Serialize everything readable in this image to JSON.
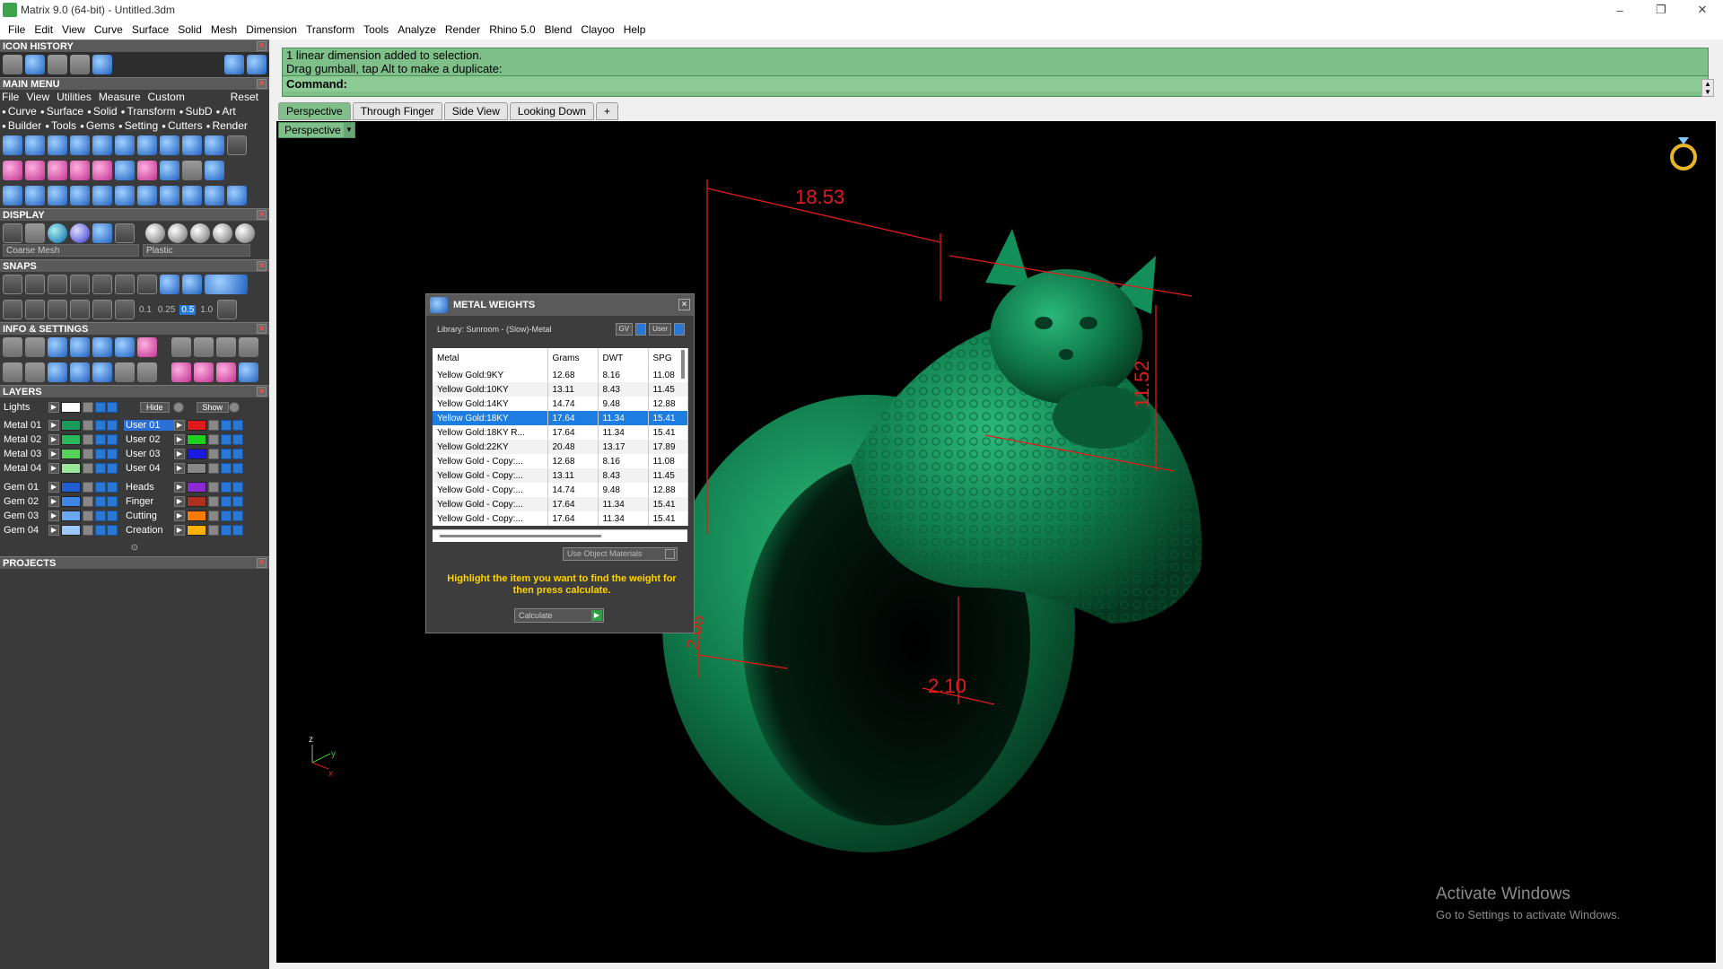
{
  "window": {
    "title": "Matrix 9.0 (64-bit) - Untitled.3dm",
    "controls": {
      "minimize": "–",
      "restore": "❐",
      "close": "✕"
    }
  },
  "menubar": [
    "File",
    "Edit",
    "View",
    "Curve",
    "Surface",
    "Solid",
    "Mesh",
    "Dimension",
    "Transform",
    "Tools",
    "Analyze",
    "Render",
    "Rhino 5.0",
    "Blend",
    "Clayoo",
    "Help"
  ],
  "left_panel": {
    "icon_history_title": "ICON HISTORY",
    "main_menu_title": "MAIN MENU",
    "main_menu_items": [
      "File",
      "View",
      "Utilities",
      "Measure",
      "Custom"
    ],
    "reset_label": "Reset",
    "categories_row1": [
      "Curve",
      "Surface",
      "Solid",
      "Transform",
      "SubD",
      "Art"
    ],
    "categories_row2": [
      "Builder",
      "Tools",
      "Gems",
      "Setting",
      "Cutters",
      "Render"
    ],
    "display_title": "DISPLAY",
    "display_mesh": "Coarse Mesh",
    "display_material": "Plastic",
    "snaps_title": "SNAPS",
    "snap_values": [
      "0.1",
      "0.25",
      "0.5",
      "1.0"
    ],
    "info_title": "INFO & SETTINGS",
    "layers_title": "LAYERS",
    "lights_label": "Lights",
    "hide_label": "Hide",
    "show_label": "Show",
    "layers_left": [
      {
        "name": "Metal 01",
        "color": "#1a9a5a"
      },
      {
        "name": "Metal 02",
        "color": "#2bb85c"
      },
      {
        "name": "Metal 03",
        "color": "#56d25a"
      },
      {
        "name": "Metal 04",
        "color": "#9be89a"
      },
      {
        "name": "Gem 01",
        "color": "#1f5fd0"
      },
      {
        "name": "Gem 02",
        "color": "#3f86e6"
      },
      {
        "name": "Gem 03",
        "color": "#6aa8f0"
      },
      {
        "name": "Gem 04",
        "color": "#9cc8f7"
      }
    ],
    "layers_right": [
      {
        "name": "User 01",
        "color": "#e01a1a"
      },
      {
        "name": "User 02",
        "color": "#20d020"
      },
      {
        "name": "User 03",
        "color": "#1a1ae0"
      },
      {
        "name": "User 04",
        "color": "#888888"
      },
      {
        "name": "Heads",
        "color": "#8a2ad0"
      },
      {
        "name": "Finger",
        "color": "#b03020"
      },
      {
        "name": "Cutting",
        "color": "#ff7a00"
      },
      {
        "name": "Creation",
        "color": "#ffb000"
      }
    ],
    "projects_title": "PROJECTS"
  },
  "command": {
    "line1": "1 linear dimension added to selection.",
    "line2": "Drag gumball, tap Alt to make a duplicate:",
    "prompt": "Command:"
  },
  "view_tabs": [
    "Perspective",
    "Through Finger",
    "Side View",
    "Looking Down"
  ],
  "add_tab_label": "+",
  "viewport": {
    "label": "Perspective",
    "dimensions": [
      "18.53",
      "11.52",
      "2.05",
      "2.10"
    ],
    "axis_z": "z",
    "axis_y": "y",
    "axis_x": "x",
    "model_color": "#0f7a4a"
  },
  "metal_weights": {
    "title": "METAL WEIGHTS",
    "library": "Library: Sunroom - (Slow)-Metal",
    "btn_gv": "GV",
    "btn_user": "User",
    "columns": [
      "Metal",
      "Grams",
      "DWT",
      "SPG"
    ],
    "rows": [
      [
        "Yellow Gold:9KY",
        "12.68",
        "8.16",
        "11.08"
      ],
      [
        "Yellow Gold:10KY",
        "13.11",
        "8.43",
        "11.45"
      ],
      [
        "Yellow Gold:14KY",
        "14.74",
        "9.48",
        "12.88"
      ],
      [
        "Yellow Gold:18KY",
        "17.64",
        "11.34",
        "15.41"
      ],
      [
        "Yellow Gold:18KY R...",
        "17.64",
        "11.34",
        "15.41"
      ],
      [
        "Yellow Gold:22KY",
        "20.48",
        "13.17",
        "17.89"
      ],
      [
        "Yellow Gold - Copy:...",
        "12.68",
        "8.16",
        "11.08"
      ],
      [
        "Yellow Gold - Copy:...",
        "13.11",
        "8.43",
        "11.45"
      ],
      [
        "Yellow Gold - Copy:...",
        "14.74",
        "9.48",
        "12.88"
      ],
      [
        "Yellow Gold - Copy:...",
        "17.64",
        "11.34",
        "15.41"
      ],
      [
        "Yellow Gold - Copy:...",
        "17.64",
        "11.34",
        "15.41"
      ]
    ],
    "selected_row": 3,
    "use_object_materials": "Use Object Materials",
    "hint": "Highlight the item you want to find the weight for then press calculate.",
    "calculate": "Calculate"
  },
  "watermark": {
    "line1": "Activate Windows",
    "line2": "Go to Settings to activate Windows."
  }
}
